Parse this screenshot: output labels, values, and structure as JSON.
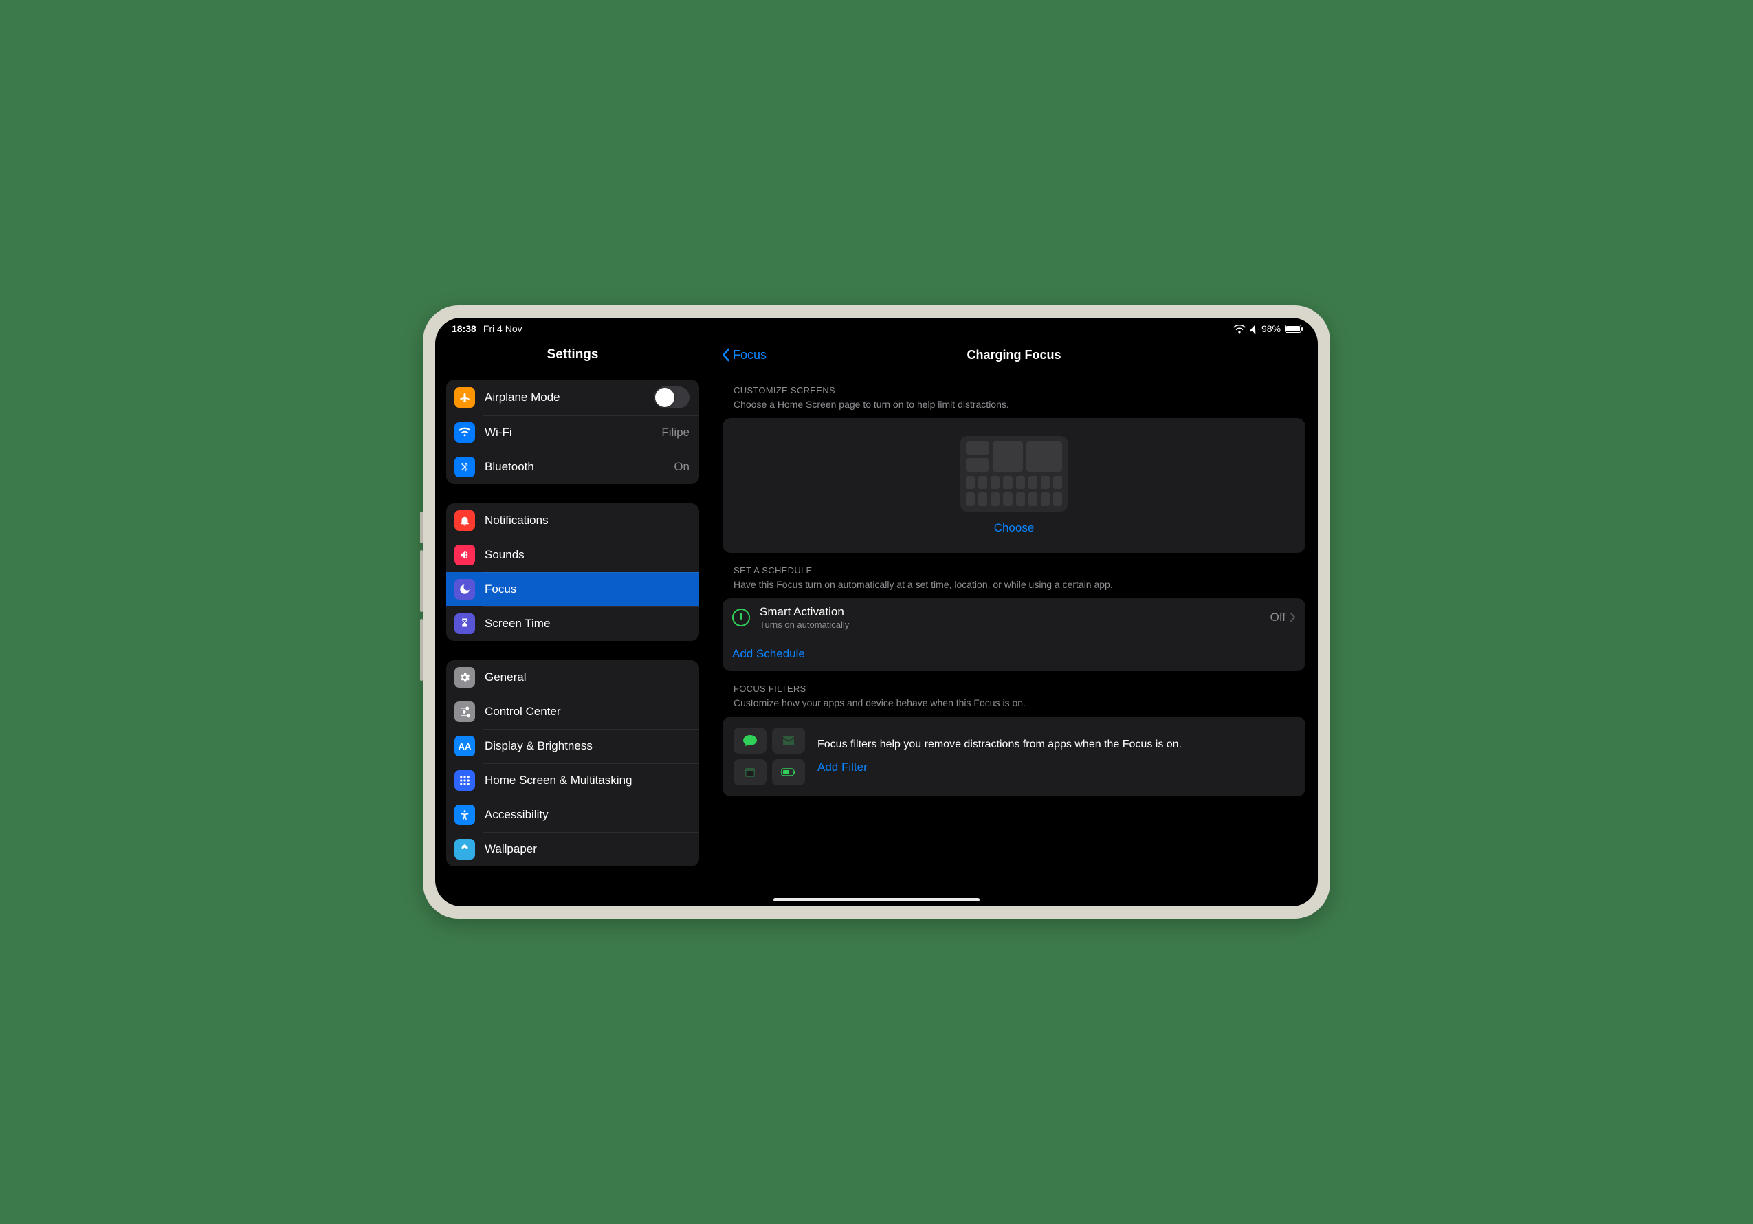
{
  "status": {
    "time": "18:38",
    "date": "Fri 4 Nov",
    "battery": "98%"
  },
  "sidebar_title": "Settings",
  "detail_back": "Focus",
  "detail_title": "Charging Focus",
  "sidebar": {
    "group1": [
      {
        "label": "Airplane Mode"
      },
      {
        "label": "Wi-Fi",
        "value": "Filipe"
      },
      {
        "label": "Bluetooth",
        "value": "On"
      }
    ],
    "group2": [
      {
        "label": "Notifications"
      },
      {
        "label": "Sounds"
      },
      {
        "label": "Focus"
      },
      {
        "label": "Screen Time"
      }
    ],
    "group3": [
      {
        "label": "General"
      },
      {
        "label": "Control Center"
      },
      {
        "label": "Display & Brightness"
      },
      {
        "label": "Home Screen & Multitasking"
      },
      {
        "label": "Accessibility"
      },
      {
        "label": "Wallpaper"
      }
    ]
  },
  "customize": {
    "heading": "CUSTOMIZE SCREENS",
    "sub": "Choose a Home Screen page to turn on to help limit distractions.",
    "choose": "Choose"
  },
  "schedule": {
    "heading": "SET A SCHEDULE",
    "sub": "Have this Focus turn on automatically at a set time, location, or while using a certain app.",
    "smart_title": "Smart Activation",
    "smart_sub": "Turns on automatically",
    "smart_value": "Off",
    "add": "Add Schedule"
  },
  "filters": {
    "heading": "FOCUS FILTERS",
    "sub": "Customize how your apps and device behave when this Focus is on.",
    "desc": "Focus filters help you remove distractions from apps when the Focus is on.",
    "add": "Add Filter"
  }
}
